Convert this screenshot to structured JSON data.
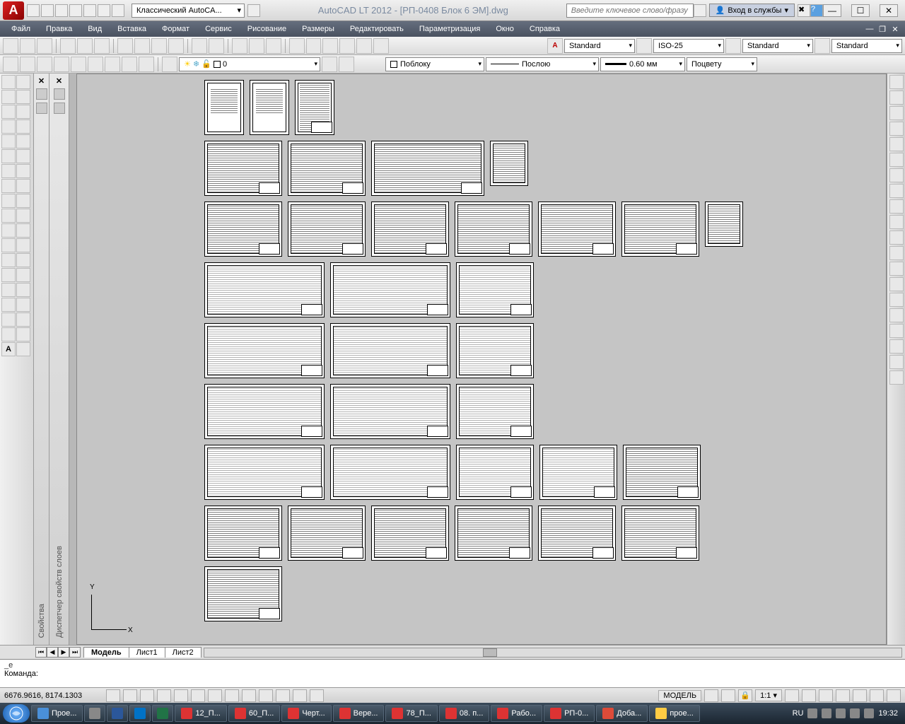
{
  "titlebar": {
    "workspace": "Классический AutoCA...",
    "title": "AutoCAD LT 2012 - [РП-0408 Блок 6 ЭМ].dwg",
    "search_placeholder": "Введите ключевое слово/фразу",
    "signin": "Вход в службы",
    "win": {
      "min": "—",
      "max": "☐",
      "close": "✕"
    }
  },
  "menu": [
    "Файл",
    "Правка",
    "Вид",
    "Вставка",
    "Формат",
    "Сервис",
    "Рисование",
    "Размеры",
    "Редактировать",
    "Параметризация",
    "Окно",
    "Справка"
  ],
  "toolbar1": {
    "annostyle": "Standard",
    "dimstyle": "ISO-25",
    "tablestyle": "Standard",
    "mlstyle": "Standard"
  },
  "toolbar2": {
    "layer": "0",
    "color": "Поблоку",
    "linetype": "Послою",
    "lineweight": "0.60 мм",
    "plotstyle": "Поцвету"
  },
  "palettes": {
    "p1_close": "✕",
    "p1_label": "Свойства",
    "p2_close": "✕",
    "p2_label": "Диспетчер свойств слоев"
  },
  "ucs": {
    "x": "X",
    "y": "Y"
  },
  "layout_tabs": {
    "nav": [
      "⏮",
      "◀",
      "▶",
      "⏭"
    ],
    "tabs": [
      "Модель",
      "Лист1",
      "Лист2"
    ]
  },
  "command": {
    "history": "_e",
    "prompt": "Команда:"
  },
  "status": {
    "coords": "6676.9616, 8174.1303",
    "model": "МОДЕЛЬ",
    "scale": "1:1"
  },
  "taskbar": {
    "items": [
      "Прое...",
      "",
      "",
      "",
      "",
      "12_П...",
      "60_П...",
      "Черт...",
      "Вере...",
      "78_П...",
      "08. п...",
      "Рабо...",
      "РП-0...",
      "Доба...",
      "прое..."
    ],
    "lang": "RU",
    "time": "19:32"
  }
}
